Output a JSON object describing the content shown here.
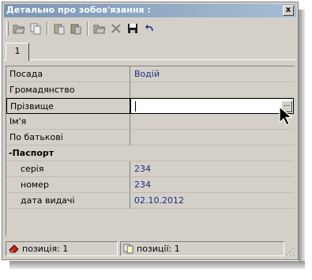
{
  "window": {
    "title": "Детально про зобов'язання :",
    "close_label": "x"
  },
  "toolbar": {
    "buttons": [
      "open-icon",
      "copy-icon",
      "paste-icon",
      "paste-special-icon",
      "open-folder-icon",
      "delete-icon",
      "save-icon",
      "undo-icon"
    ]
  },
  "tabs": [
    {
      "label": "1"
    }
  ],
  "grid": {
    "rows": [
      {
        "label": "Посада",
        "value": "Водій"
      },
      {
        "label": "Громадянство",
        "value": ""
      },
      {
        "label": "Прізвище",
        "value": ""
      },
      {
        "label": "Ім'я",
        "value": ""
      },
      {
        "label": "По батькові",
        "value": ""
      }
    ],
    "group": {
      "toggle": "-",
      "label": "Паспорт"
    },
    "sub_rows": [
      {
        "label": "серія",
        "value": "234"
      },
      {
        "label": "номер",
        "value": "234"
      },
      {
        "label": "дата видачі",
        "value": "02.10.2012"
      }
    ],
    "ellipsis_label": "..."
  },
  "status": {
    "left": "позиція: 1",
    "right": "позиції: 1"
  },
  "colors": {
    "title_start": "#7a96b4",
    "title_end": "#a6bcd4",
    "value_text": "#1c2c8c",
    "chrome": "#d4d0c8"
  }
}
